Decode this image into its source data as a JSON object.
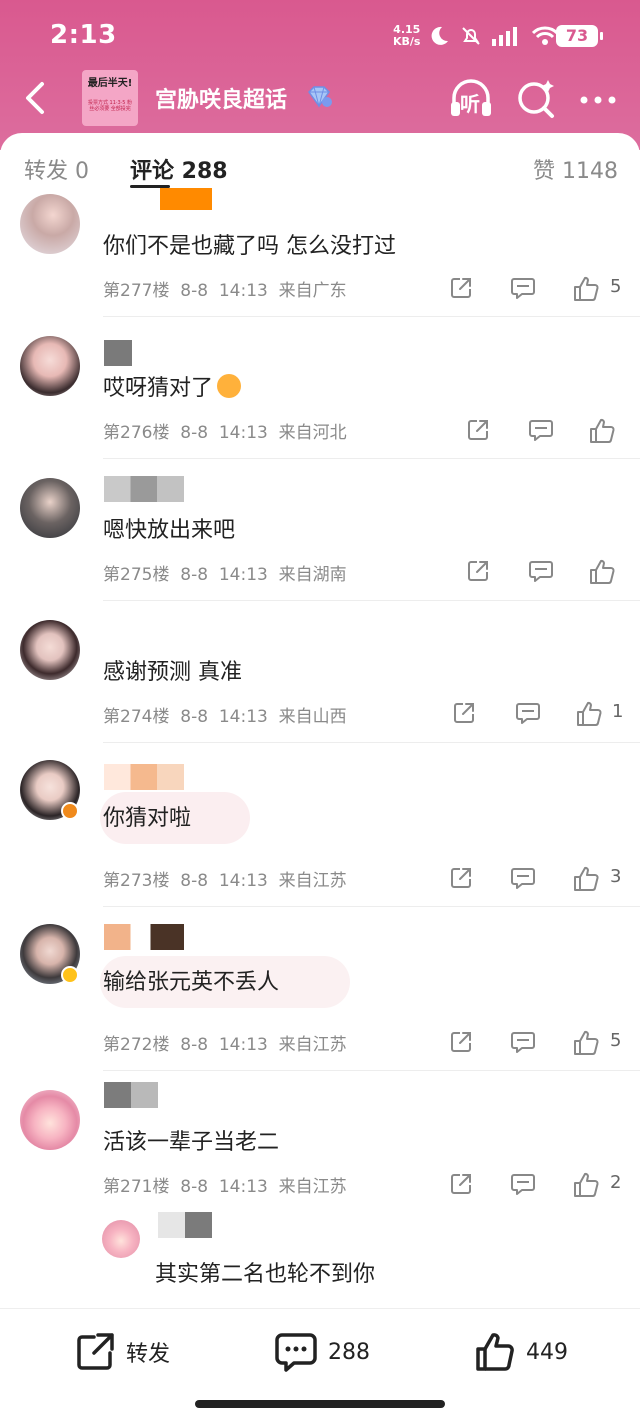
{
  "status_bar": {
    "time": "2:13",
    "net_speed_value": "4.15",
    "net_speed_unit": "KB/s",
    "battery": "73"
  },
  "nav": {
    "topic_title": "宫胁咲良超话",
    "thumb_title": "最后半天!",
    "thumb_subtitle": "投票方式 11·3·5 粉丝必须要 全部投完",
    "listen_label": "听"
  },
  "tabs": {
    "repost": "转发 0",
    "comment": "评论 288",
    "like": "赞 1148"
  },
  "comments": [
    {
      "text": "你们不是也藏了吗 怎么没打过",
      "floor": "第277楼",
      "date": "8-8",
      "time": "14:13",
      "location": "来自广东",
      "likes": "5"
    },
    {
      "text": "哎呀猜对了",
      "floor": "第276楼",
      "date": "8-8",
      "time": "14:13",
      "location": "来自河北",
      "likes": ""
    },
    {
      "text": "嗯快放出来吧",
      "floor": "第275楼",
      "date": "8-8",
      "time": "14:13",
      "location": "来自湖南",
      "likes": ""
    },
    {
      "text": "感谢预测 真准",
      "floor": "第274楼",
      "date": "8-8",
      "time": "14:13",
      "location": "来自山西",
      "likes": "1"
    },
    {
      "text": "你猜对啦",
      "floor": "第273楼",
      "date": "8-8",
      "time": "14:13",
      "location": "来自江苏",
      "likes": "3"
    },
    {
      "text": "输给张元英不丢人",
      "floor": "第272楼",
      "date": "8-8",
      "time": "14:13",
      "location": "来自江苏",
      "likes": "5"
    },
    {
      "text": "活该一辈子当老二",
      "floor": "第271楼",
      "date": "8-8",
      "time": "14:13",
      "location": "来自江苏",
      "likes": "2"
    }
  ],
  "reply": {
    "text": "其实第二名也轮不到你"
  },
  "bottom": {
    "repost": "转发",
    "comments": "288",
    "likes": "449"
  },
  "colors": {
    "header": "#d9598f",
    "accent_orange": "#ff8a00",
    "text_gray": "#8a8a8a"
  }
}
